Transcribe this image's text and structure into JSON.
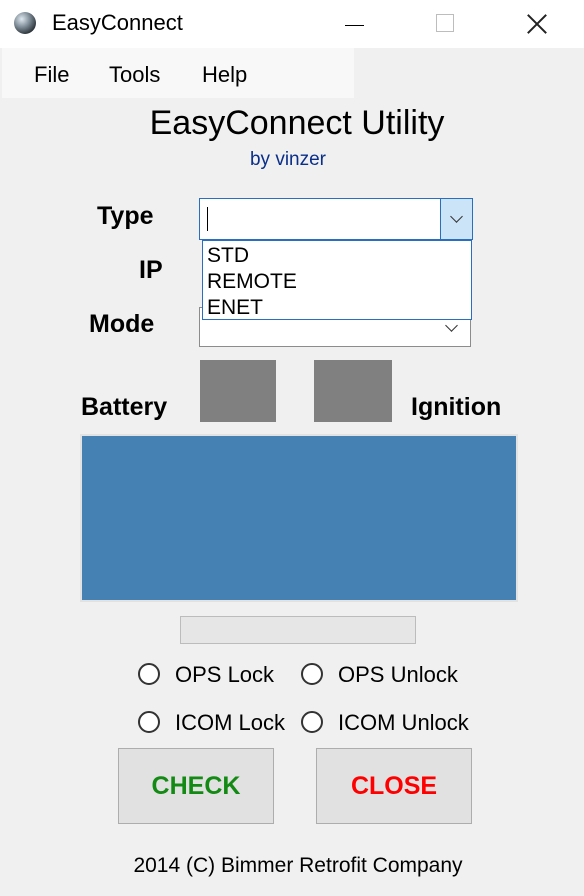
{
  "window": {
    "title": "EasyConnect",
    "icon": "globe-icon",
    "controls": [
      "minimize-icon",
      "maximize-icon",
      "close-icon"
    ]
  },
  "menu": {
    "items": [
      "File",
      "Tools",
      "Help"
    ]
  },
  "header": {
    "title": "EasyConnect Utility",
    "subtitle": "by vinzer"
  },
  "form": {
    "type_label": "Type",
    "type_value": "",
    "type_options": [
      "STD",
      "REMOTE",
      "ENET"
    ],
    "ip_label": "IP",
    "mode_label": "Mode",
    "mode_value": ""
  },
  "status": {
    "battery_label": "Battery",
    "ignition_label": "Ignition",
    "battery_color": "#808080",
    "ignition_color": "#808080",
    "log_color": "#4681b4",
    "progress": 0
  },
  "options": {
    "ops_lock": "OPS Lock",
    "ops_unlock": "OPS Unlock",
    "icom_lock": "ICOM Lock",
    "icom_unlock": "ICOM Unlock"
  },
  "buttons": {
    "check": "CHECK",
    "check_color": "#138a13",
    "close": "CLOSE",
    "close_color": "#ff0000"
  },
  "footer": {
    "copyright": "2014 (C) Bimmer Retrofit Company"
  }
}
